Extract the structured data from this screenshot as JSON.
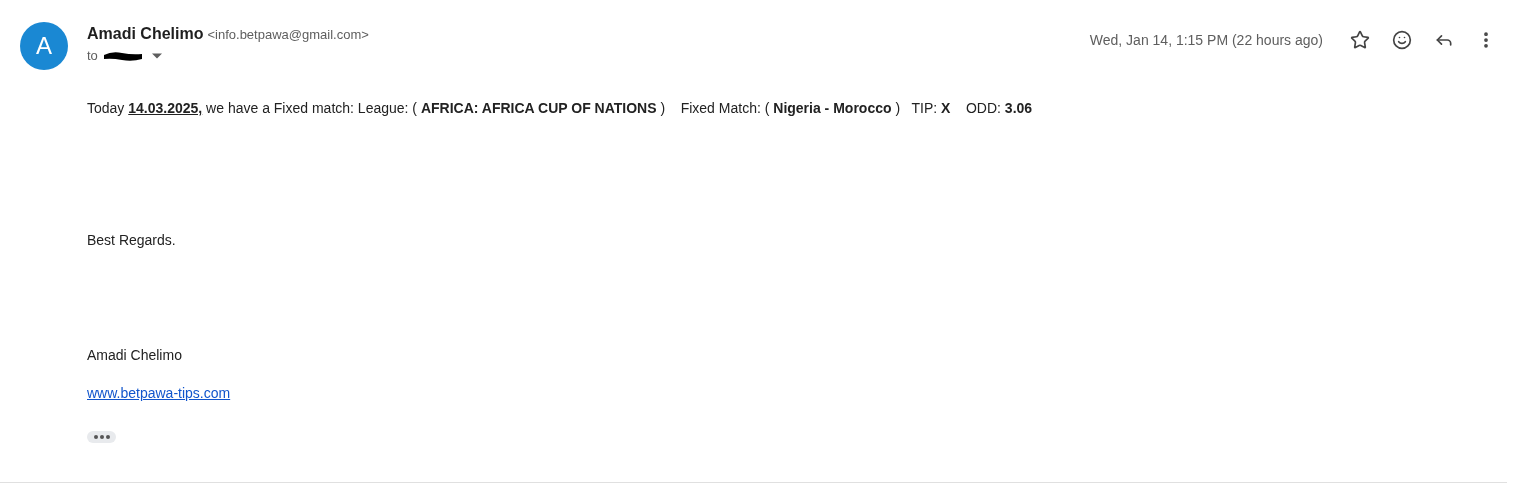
{
  "sender": {
    "avatar_letter": "A",
    "name": "Amadi Chelimo",
    "email": "<info.betpawa@gmail.com>",
    "to_label": "to"
  },
  "timestamp": "Wed, Jan 14, 1:15 PM (22 hours ago)",
  "body": {
    "match_line": [
      {
        "text": "Today ",
        "bold": false,
        "underline": false
      },
      {
        "text": "14.03.2025,",
        "bold": true,
        "underline": true
      },
      {
        "text": " we have a Fixed match: League: ( ",
        "bold": false,
        "underline": false
      },
      {
        "text": "AFRICA: AFRICA CUP OF NATIONS",
        "bold": true,
        "underline": false
      },
      {
        "text": " )    Fixed Match: ( ",
        "bold": false,
        "underline": false
      },
      {
        "text": "Nigeria - Morocco",
        "bold": true,
        "underline": false
      },
      {
        "text": " )   TIP: ",
        "bold": false,
        "underline": false
      },
      {
        "text": "X",
        "bold": true,
        "underline": false
      },
      {
        "text": "    ODD: ",
        "bold": false,
        "underline": false
      },
      {
        "text": "3.06",
        "bold": true,
        "underline": false
      }
    ],
    "closing": "Best Regards.",
    "signature_name": "Amadi Chelimo",
    "link": "www.betpawa-tips.com"
  }
}
